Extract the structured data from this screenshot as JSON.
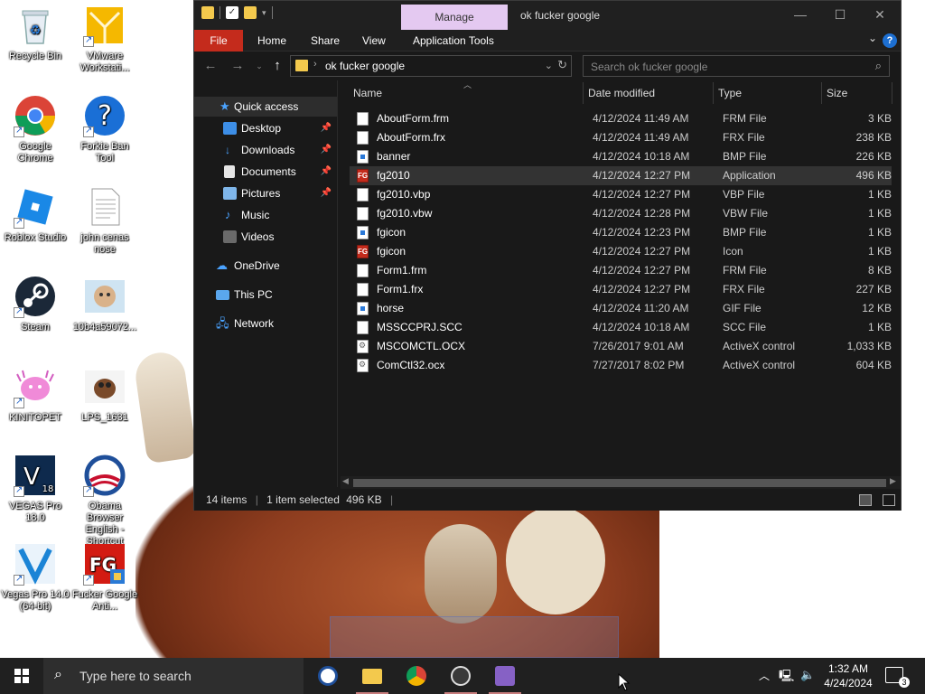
{
  "desktop": {
    "icons": [
      {
        "label": "Recycle Bin",
        "icon": "recycle-bin-icon"
      },
      {
        "label": "VMware Workstati...",
        "icon": "vmware-icon"
      },
      {
        "label": "Google Chrome",
        "icon": "chrome-icon"
      },
      {
        "label": "Forkie Ban Tool",
        "icon": "question-icon"
      },
      {
        "label": "Roblox Studio",
        "icon": "roblox-studio-icon"
      },
      {
        "label": "john cenas nose",
        "icon": "text-document-icon"
      },
      {
        "label": "Steam",
        "icon": "steam-icon"
      },
      {
        "label": "10b4a59072...",
        "icon": "image-file-icon"
      },
      {
        "label": "KINITOPET",
        "icon": "kinitopet-icon"
      },
      {
        "label": "LPS_1631",
        "icon": "image-file-icon"
      },
      {
        "label": "VEGAS Pro 18.0",
        "icon": "vegas-pro-18-icon"
      },
      {
        "label": "Obama Browser English - Shortcut",
        "icon": "obama-browser-icon"
      },
      {
        "label": "Vegas Pro 14.0 (64-bit)",
        "icon": "vegas-pro-14-icon"
      },
      {
        "label": "Fucker Google Anti...",
        "icon": "fg-app-icon"
      }
    ]
  },
  "explorer": {
    "manage_tab": "Manage",
    "title": "ok fucker google",
    "ribbon_tabs": {
      "file": "File",
      "home": "Home",
      "share": "Share",
      "view": "View",
      "app_tools": "Application Tools"
    },
    "address_path": "ok fucker google",
    "search_placeholder": "Search ok fucker google",
    "nav": {
      "quick_access": "Quick access",
      "desktop": "Desktop",
      "downloads": "Downloads",
      "documents": "Documents",
      "pictures": "Pictures",
      "music": "Music",
      "videos": "Videos",
      "onedrive": "OneDrive",
      "this_pc": "This PC",
      "network": "Network"
    },
    "columns": {
      "name": "Name",
      "date": "Date modified",
      "type": "Type",
      "size": "Size"
    },
    "files": [
      {
        "name": "AboutForm.frm",
        "date": "4/12/2024 11:49 AM",
        "type": "FRM File",
        "size": "3 KB",
        "icon": "doc"
      },
      {
        "name": "AboutForm.frx",
        "date": "4/12/2024 11:49 AM",
        "type": "FRX File",
        "size": "238 KB",
        "icon": "doc"
      },
      {
        "name": "banner",
        "date": "4/12/2024 10:18 AM",
        "type": "BMP File",
        "size": "226 KB",
        "icon": "bmp"
      },
      {
        "name": "fg2010",
        "date": "4/12/2024 12:27 PM",
        "type": "Application",
        "size": "496 KB",
        "icon": "app"
      },
      {
        "name": "fg2010.vbp",
        "date": "4/12/2024 12:27 PM",
        "type": "VBP File",
        "size": "1 KB",
        "icon": "doc"
      },
      {
        "name": "fg2010.vbw",
        "date": "4/12/2024 12:28 PM",
        "type": "VBW File",
        "size": "1 KB",
        "icon": "doc"
      },
      {
        "name": "fgicon",
        "date": "4/12/2024 12:23 PM",
        "type": "BMP File",
        "size": "1 KB",
        "icon": "bmp"
      },
      {
        "name": "fgicon",
        "date": "4/12/2024 12:27 PM",
        "type": "Icon",
        "size": "1 KB",
        "icon": "app"
      },
      {
        "name": "Form1.frm",
        "date": "4/12/2024 12:27 PM",
        "type": "FRM File",
        "size": "8 KB",
        "icon": "doc"
      },
      {
        "name": "Form1.frx",
        "date": "4/12/2024 12:27 PM",
        "type": "FRX File",
        "size": "227 KB",
        "icon": "doc"
      },
      {
        "name": "horse",
        "date": "4/12/2024 11:20 AM",
        "type": "GIF File",
        "size": "12 KB",
        "icon": "bmp"
      },
      {
        "name": "MSSCCPRJ.SCC",
        "date": "4/12/2024 10:18 AM",
        "type": "SCC File",
        "size": "1 KB",
        "icon": "doc"
      },
      {
        "name": "MSCOMCTL.OCX",
        "date": "7/26/2017 9:01 AM",
        "type": "ActiveX control",
        "size": "1,033 KB",
        "icon": "ocx"
      },
      {
        "name": "ComCtl32.ocx",
        "date": "7/27/2017 8:02 PM",
        "type": "ActiveX control",
        "size": "604 KB",
        "icon": "ocx"
      }
    ],
    "app_icon_text": "FG",
    "status": {
      "items": "14 items",
      "selected": "1 item selected",
      "size": "496 KB"
    }
  },
  "taskbar": {
    "search_placeholder": "Type here to search",
    "time": "1:32 AM",
    "date": "4/24/2024",
    "notification_count": "3"
  },
  "colors": {
    "file_tab": "#c42b1c",
    "manage_tab": "#e4c9f1",
    "folder": "#f3c94d",
    "taskbar": "#202020"
  }
}
